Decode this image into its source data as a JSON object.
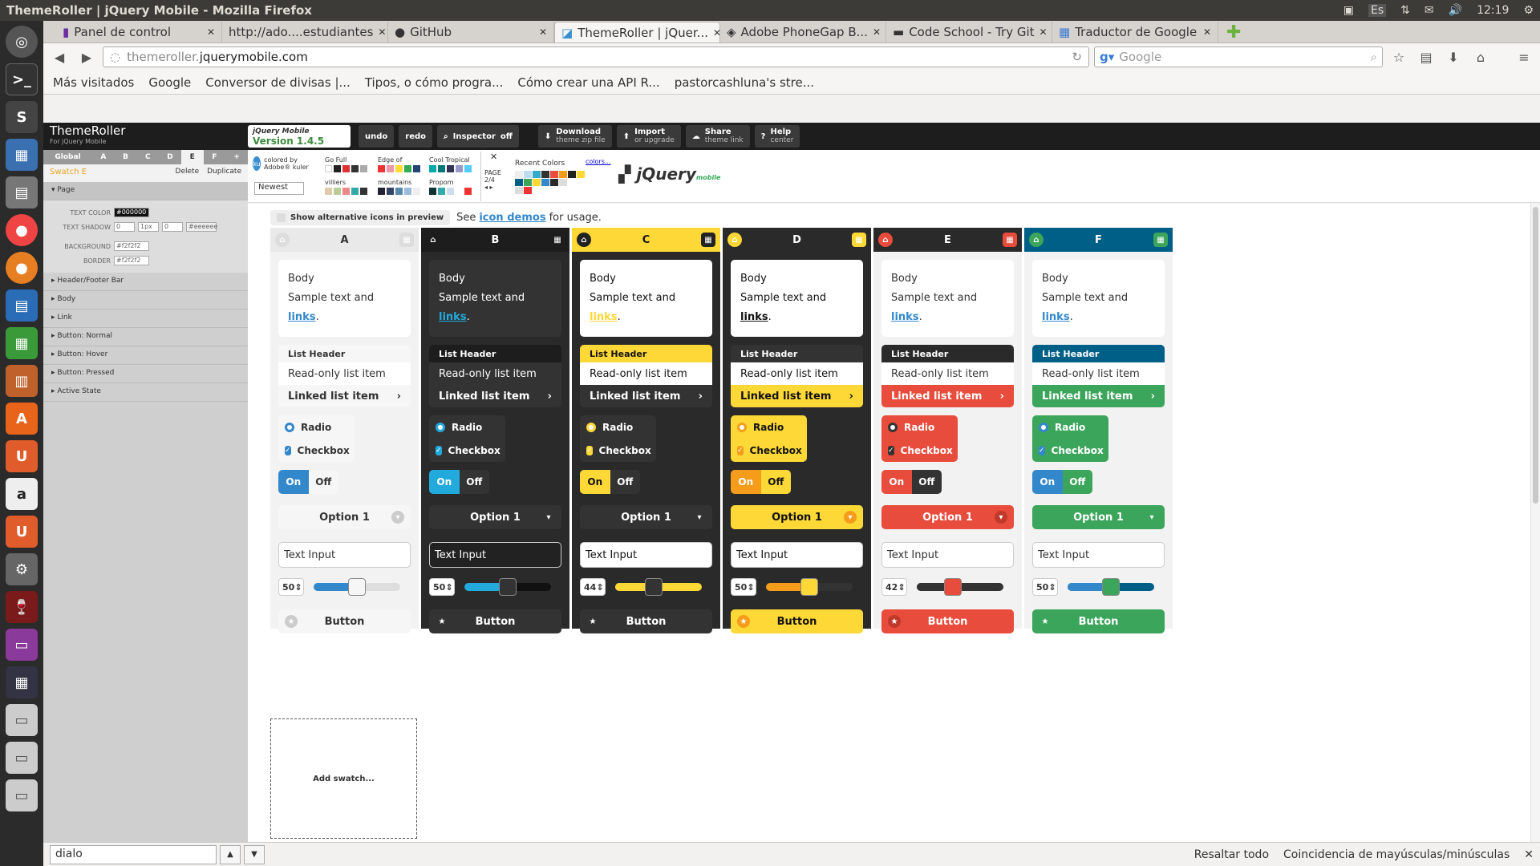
{
  "window": {
    "title": "ThemeRoller | jQuery Mobile - Mozilla Firefox",
    "clock": "12:19",
    "lang": "Es"
  },
  "tabs": [
    {
      "label": "Panel de control",
      "active": false
    },
    {
      "label": "http://ado....estudiantes",
      "active": false
    },
    {
      "label": "GitHub",
      "active": false
    },
    {
      "label": "ThemeRoller | jQuer...",
      "active": true
    },
    {
      "label": "Adobe PhoneGap B...",
      "active": false
    },
    {
      "label": "Code School - Try Git",
      "active": false
    },
    {
      "label": "Traductor de Google",
      "active": false
    }
  ],
  "nav": {
    "url_host": "themeroller.",
    "url_domain": "jquerymobile.com",
    "search_placeholder": "Google"
  },
  "bookmarks": [
    "Más visitados",
    "Google",
    "Conversor de divisas |...",
    "Tipos, o cómo progra...",
    "Cómo crear una API R...",
    "pastorcashluna's stre..."
  ],
  "toolbar": {
    "logo": "ThemeRoller",
    "logo_sub": "For jQuery Mobile",
    "version_brand": "jQuery Mobile",
    "version": "Version 1.4.5",
    "undo": "undo",
    "redo": "redo",
    "inspector": "Inspector",
    "inspector_state": "off",
    "download": "Download",
    "download_sub": "theme zip file",
    "import": "Import",
    "import_sub": "or upgrade",
    "share": "Share",
    "share_sub": "theme link",
    "help": "Help",
    "help_sub": "center"
  },
  "sidebar": {
    "tabs": [
      "Global",
      "A",
      "B",
      "C",
      "D",
      "E",
      "F",
      "+"
    ],
    "swatch_title": "Swatch E",
    "delete": "Delete",
    "duplicate": "Duplicate",
    "page_section": "Page",
    "fields": {
      "text_color_label": "TEXT COLOR",
      "text_color": "#000000",
      "text_shadow_label": "TEXT SHADOW",
      "ts1": "0",
      "ts2": "1px",
      "ts3": "0",
      "ts4": "#eeeeee",
      "background_label": "BACKGROUND",
      "background": "#f2f2f2",
      "border_label": "BORDER",
      "border": "#f2f2f2"
    },
    "sections": [
      "Header/Footer Bar",
      "Body",
      "Link",
      "Button: Normal",
      "Button: Hover",
      "Button: Pressed",
      "Active State"
    ]
  },
  "themes_bar": {
    "kuler": "colored by Adobe® kuler",
    "sort": "Newest",
    "palettes": [
      "Go Full",
      "Edge of",
      "Cool Tropical",
      "villiers",
      "mountains",
      "Propom"
    ],
    "page_label": "PAGE",
    "page": "2/4",
    "recent": "Recent Colors",
    "colors_link": "colors..."
  },
  "preview": {
    "alt_icons": "Show alternative icons in preview",
    "see": "See",
    "icon_demos": "icon demos",
    "for_usage": "for usage.",
    "add_swatch": "Add swatch..."
  },
  "swatch_text": {
    "body": "Body",
    "sample": "Sample text and",
    "links": "links",
    "list_header": "List Header",
    "readonly": "Read-only list item",
    "linked": "Linked list item",
    "radio": "Radio",
    "checkbox": "Checkbox",
    "on": "On",
    "off": "Off",
    "option": "Option 1",
    "text_input": "Text Input",
    "button": "Button"
  },
  "swatches": [
    {
      "letter": "A",
      "slider": "50",
      "fill": 0.5
    },
    {
      "letter": "B",
      "slider": "50",
      "fill": 0.5
    },
    {
      "letter": "C",
      "slider": "44",
      "fill": 0.44
    },
    {
      "letter": "D",
      "slider": "50",
      "fill": 0.5
    },
    {
      "letter": "E",
      "slider": "42",
      "fill": 0.42
    },
    {
      "letter": "F",
      "slider": "50",
      "fill": 0.5
    }
  ],
  "findbar": {
    "query": "dialo",
    "highlight": "Resaltar todo",
    "match_case": "Coincidencia de mayúsculas/minúsculas"
  },
  "colors": {
    "blue": "#3388cc",
    "yellow": "#fdd836",
    "red": "#e74c3c",
    "green": "#3ca55c",
    "teal": "#005f87",
    "dark": "#2a2a2a",
    "orange": "#f59d1b"
  }
}
